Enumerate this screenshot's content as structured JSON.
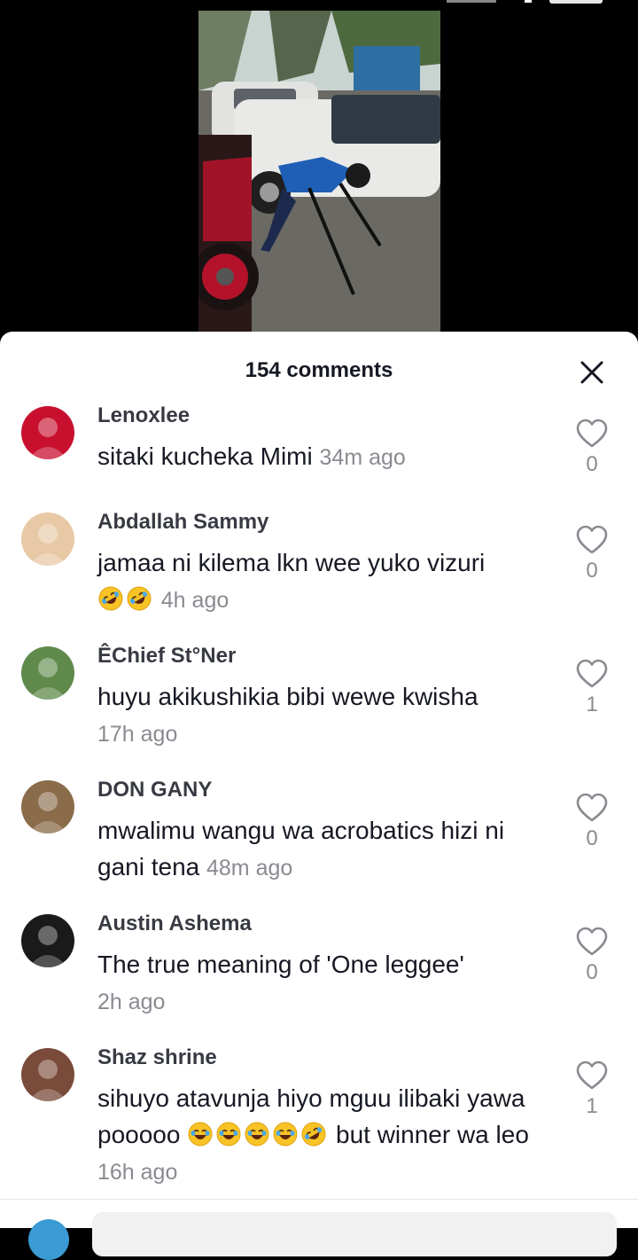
{
  "sheet": {
    "comment_count": "154 comments",
    "close_icon": "close-icon"
  },
  "comments": [
    {
      "username": "Lenoxlee",
      "text": "sitaki kucheka Mimi",
      "time": "34m ago",
      "likes": "0",
      "avatar_color": "#c8102e"
    },
    {
      "username": "Abdallah Sammy",
      "text": "jamaa ni kilema lkn wee yuko vizuri",
      "emojis": [
        "rofl-emoji",
        "rofl-emoji"
      ],
      "time": "4h ago",
      "likes": "0",
      "avatar_color": "#e8c9a6"
    },
    {
      "username": "ÊChief St°Ner",
      "text": "huyu akikushikia bibi wewe kwisha",
      "time": "17h ago",
      "likes": "1",
      "avatar_color": "#5f8a4c"
    },
    {
      "username": "DON GANY",
      "text": "mwalimu wangu wa acrobatics hizi ni gani tena",
      "time": "48m ago",
      "likes": "0",
      "avatar_color": "#8a6b4a"
    },
    {
      "username": "Austin Ashema",
      "text": "The true meaning of 'One leggee'",
      "time": "2h ago",
      "likes": "0",
      "avatar_color": "#1a1a1a"
    },
    {
      "username": "Shaz shrine",
      "text_before": "sihuyo atavunja hiyo mguu ilibaki yawa pooooo",
      "emojis": [
        "joy-emoji",
        "joy-emoji",
        "joy-emoji",
        "joy-emoji",
        "rofl-emoji"
      ],
      "text_after": "but winner wa leo",
      "time": "16h ago",
      "likes": "1",
      "avatar_color": "#7a4a3a"
    }
  ]
}
